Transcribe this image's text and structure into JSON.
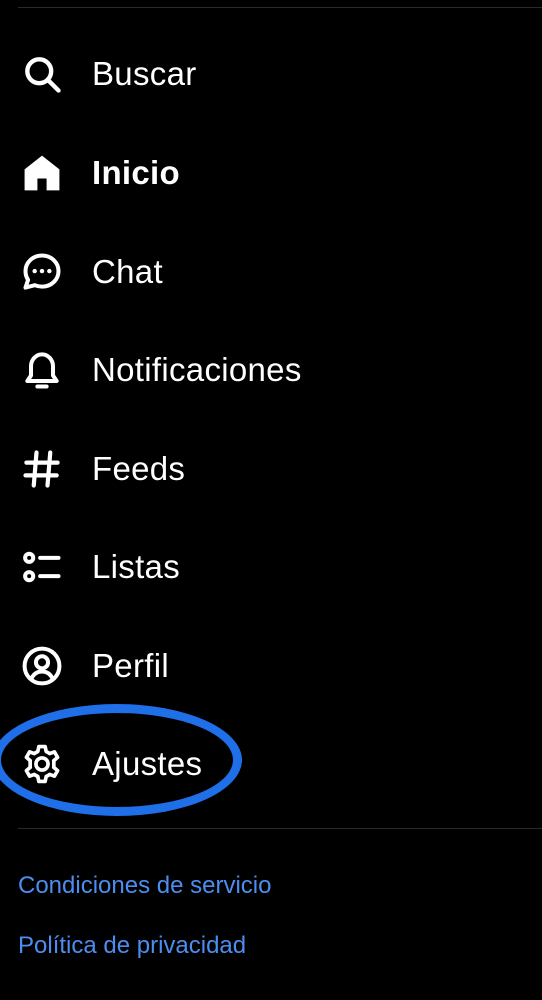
{
  "menu": {
    "items": [
      {
        "key": "search",
        "label": "Buscar",
        "icon": "search-icon"
      },
      {
        "key": "home",
        "label": "Inicio",
        "icon": "home-icon",
        "active": true
      },
      {
        "key": "chat",
        "label": "Chat",
        "icon": "chat-bubble-icon"
      },
      {
        "key": "notifications",
        "label": "Notificaciones",
        "icon": "bell-icon"
      },
      {
        "key": "feeds",
        "label": "Feeds",
        "icon": "hashtag-icon"
      },
      {
        "key": "lists",
        "label": "Listas",
        "icon": "list-icon"
      },
      {
        "key": "profile",
        "label": "Perfil",
        "icon": "user-circle-icon"
      },
      {
        "key": "settings",
        "label": "Ajustes",
        "icon": "gear-icon",
        "highlighted": true
      }
    ]
  },
  "footer": {
    "terms_label": "Condiciones de servicio",
    "privacy_label": "Política de privacidad"
  },
  "colors": {
    "background": "#000000",
    "text": "#ffffff",
    "link": "#4b8ef0",
    "highlight": "#1f6fe8"
  }
}
